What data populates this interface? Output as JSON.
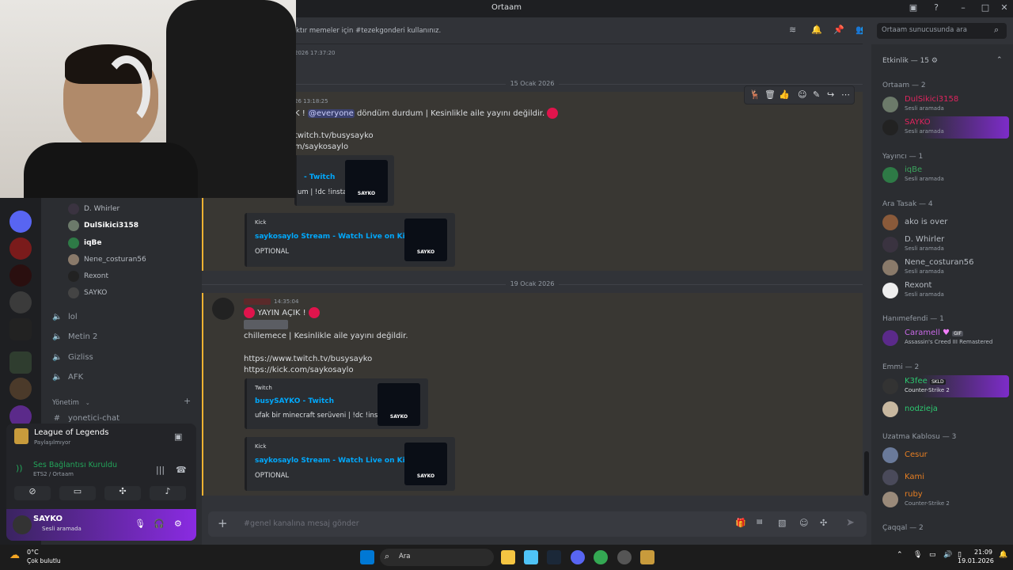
{
  "window": {
    "title": "Ortaam"
  },
  "channel_header": {
    "topic": "ktır memeler için #tezekgonderi kullanınız.",
    "search_placeholder": "Ortaam sunucusunda ara"
  },
  "channels": {
    "voice_users": [
      "D. Whirler",
      "DulSikici3158",
      "iqBe",
      "Nene_costuran56",
      "Rexont",
      "SAYKO"
    ],
    "voice_channels": [
      "lol",
      "Metin 2",
      "Gizliss",
      "AFK"
    ],
    "category": "Yönetim",
    "text_channel": "yonetici-chat"
  },
  "activity": {
    "game": "League of Legends",
    "status": "Paylaşılmıyor"
  },
  "voice_connection": {
    "label": "Ses Bağlantısı Kuruldu",
    "location": "ETS2 / Ortaam"
  },
  "user": {
    "name": "SAYKO",
    "status": "Sesli aramada"
  },
  "messages": {
    "partial_timestamp": "2026 17:37:20",
    "date1": "15 Ocak 2026",
    "msg1": {
      "time": "26 13:18:25",
      "prefix": "K ! ",
      "mention": "@everyone",
      "text": " döndüm durdum | Kesinlikle aile yayını değildir.",
      "link1": "twitch.tv/busysayko",
      "link2": "m/saykosaylo",
      "twitch_title": "- Twitch",
      "twitch_desc": "um | !dc !insta",
      "kick_provider": "Kick",
      "kick_title": "saykosaylo Stream - Watch Live on Kick",
      "kick_desc": "OPTIONAL"
    },
    "date2": "19 Ocak 2026",
    "msg2": {
      "time": "14:35:04",
      "title": "YAYIN AÇIK !",
      "text": "chillemece | Kesinlikle aile yayını değildir.",
      "link1": "https://www.twitch.tv/busysayko",
      "link2": "https://kick.com/saykosaylo",
      "twitch_provider": "Twitch",
      "twitch_title": "busySAYKO - Twitch",
      "twitch_desc": "ufak bir minecraft serüveni | !dc !insta",
      "kick_provider": "Kick",
      "kick_title": "saykosaylo Stream - Watch Live on Kick",
      "kick_desc": "OPTIONAL"
    },
    "thumb_label": "SAYKO"
  },
  "composer": {
    "placeholder": "#genel kanalına mesaj gönder"
  },
  "members": {
    "activity_header": "Etkinlik — 15",
    "sections": [
      {
        "title": "Ortaam — 2",
        "members": [
          {
            "name": "DulSikici3158",
            "status": "Sesli aramada",
            "color": "#e0245e"
          },
          {
            "name": "SAYKO",
            "status": "Sesli aramada",
            "color": "#e0245e"
          }
        ]
      },
      {
        "title": "Yayıncı — 1",
        "members": [
          {
            "name": "iqBe",
            "status": "Sesli aramada",
            "color": "#3ba55d"
          }
        ]
      },
      {
        "title": "Ara Tasak — 4",
        "members": [
          {
            "name": "ako is over",
            "status": "",
            "color": "#b5bac1"
          },
          {
            "name": "D. Whirler",
            "status": "Sesli aramada",
            "color": "#b5bac1"
          },
          {
            "name": "Nene_costuran56",
            "status": "Sesli aramada",
            "color": "#b5bac1"
          },
          {
            "name": "Rexont",
            "status": "Sesli aramada",
            "color": "#b5bac1"
          }
        ]
      },
      {
        "title": "Hanımefendi — 1",
        "members": [
          {
            "name": "Caramell",
            "status": "Assassin's Creed III Remastered",
            "color": "#c969e8"
          }
        ]
      },
      {
        "title": "Emmi — 2",
        "members": [
          {
            "name": "K3fee",
            "status": "Counter-Strike 2",
            "color": "#2dc770"
          },
          {
            "name": "nodzieja",
            "status": "",
            "color": "#2dc770"
          }
        ]
      },
      {
        "title": "Uzatma Kablosu — 3",
        "members": [
          {
            "name": "Cesur",
            "status": "",
            "color": "#e67e22"
          },
          {
            "name": "Kami",
            "status": "",
            "color": "#e67e22"
          },
          {
            "name": "ruby",
            "status": "Counter-Strike 2",
            "color": "#e67e22"
          }
        ]
      },
      {
        "title": "Çaqqal — 2",
        "members": []
      }
    ],
    "badges": {
      "caramell": "GIF",
      "k3fee": "SKLD"
    }
  },
  "taskbar": {
    "weather_temp": "0°C",
    "weather_text": "Çok bulutlu",
    "search": "Ara",
    "time": "21:09",
    "date": "19.01.2026"
  }
}
